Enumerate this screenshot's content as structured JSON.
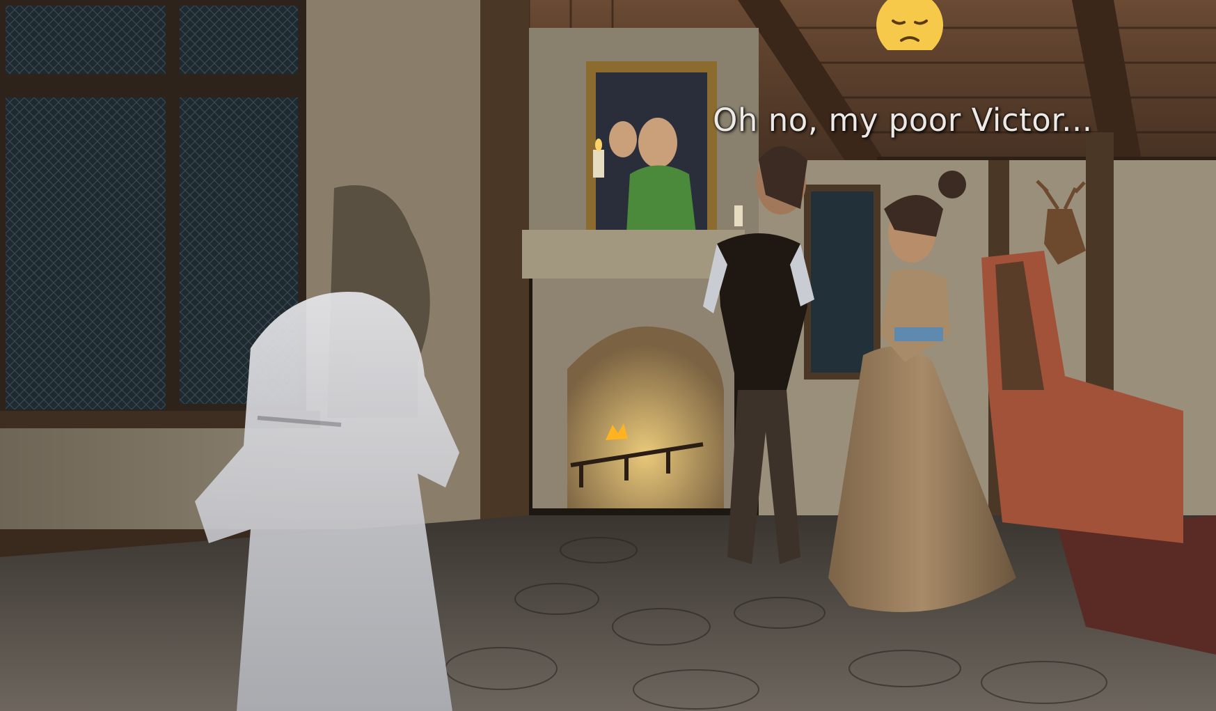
{
  "scene": {
    "type": "3d-game-view",
    "location": "manor-living-room",
    "characters": [
      "ghost-player",
      "man-in-vest",
      "woman-in-gown",
      "portrait-man"
    ]
  },
  "emote": {
    "icon": "sad-face-icon",
    "color": "#f7c94a"
  },
  "dialogue": {
    "text": "Oh no, my poor Victor..."
  }
}
